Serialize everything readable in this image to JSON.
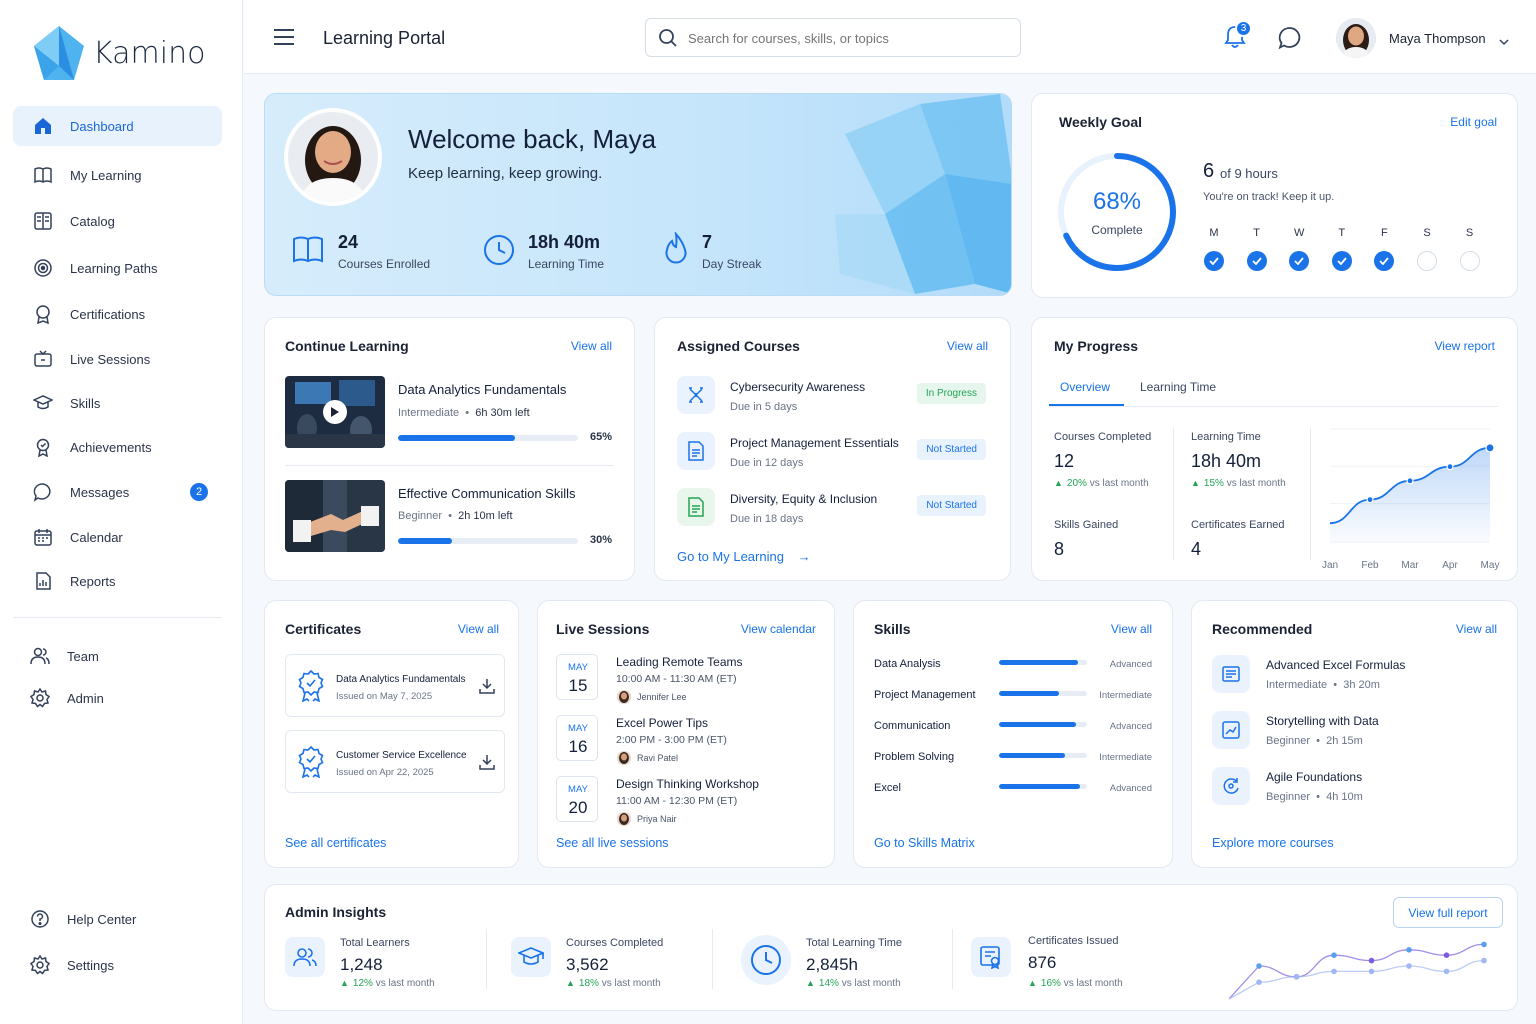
{
  "app": {
    "name": "Kamino",
    "title": "Learning Portal"
  },
  "search": {
    "placeholder": "Search for courses, skills, or topics"
  },
  "user": {
    "name": "Maya Thompson",
    "notifications": "3"
  },
  "sidebar": {
    "items": [
      {
        "label": "Dashboard",
        "icon": "home-icon"
      },
      {
        "label": "My Learning",
        "icon": "book-icon"
      },
      {
        "label": "Catalog",
        "icon": "catalog-icon"
      },
      {
        "label": "Learning Paths",
        "icon": "target-icon"
      },
      {
        "label": "Certifications",
        "icon": "certificate-icon"
      },
      {
        "label": "Live Sessions",
        "icon": "live-icon"
      },
      {
        "label": "Skills",
        "icon": "graduation-icon"
      },
      {
        "label": "Achievements",
        "icon": "medal-icon"
      },
      {
        "label": "Messages",
        "icon": "chat-icon",
        "badge": "2"
      },
      {
        "label": "Calendar",
        "icon": "calendar-icon"
      },
      {
        "label": "Reports",
        "icon": "report-icon"
      }
    ],
    "admin": [
      {
        "label": "Team"
      },
      {
        "label": "Admin"
      }
    ],
    "footer": [
      {
        "label": "Help Center"
      },
      {
        "label": "Settings"
      }
    ]
  },
  "welcome": {
    "title": "Welcome back, Maya",
    "subtitle": "Keep learning, keep growing.",
    "stats": [
      {
        "value": "24",
        "label": "Courses Enrolled"
      },
      {
        "value": "18h 40m",
        "label": "Learning Time"
      },
      {
        "value": "7",
        "label": "Day Streak"
      }
    ]
  },
  "weekly_goal": {
    "title": "Weekly Goal",
    "edit": "Edit goal",
    "percent": "68%",
    "percent_value": 68,
    "complete": "Complete",
    "done": "6",
    "of": "of 9 hours",
    "message": "You're on track! Keep it up.",
    "days": [
      "M",
      "T",
      "W",
      "T",
      "F",
      "S",
      "S"
    ],
    "checked": [
      true,
      true,
      true,
      true,
      true,
      false,
      false
    ]
  },
  "continue": {
    "title": "Continue Learning",
    "view_all": "View all",
    "courses": [
      {
        "title": "Data Analytics Fundamentals",
        "level": "Intermediate",
        "left": "6h 30m left",
        "progress": "65%",
        "pct": 65
      },
      {
        "title": "Effective Communication Skills",
        "level": "Beginner",
        "left": "2h 10m left",
        "progress": "30%",
        "pct": 30
      }
    ]
  },
  "assigned": {
    "title": "Assigned Courses",
    "view_all": "View all",
    "go": "Go to My Learning",
    "items": [
      {
        "title": "Cybersecurity Awareness",
        "due": "Due in 5 days",
        "status": "In Progress"
      },
      {
        "title": "Project Management Essentials",
        "due": "Due in 12 days",
        "status": "Not Started"
      },
      {
        "title": "Diversity, Equity & Inclusion",
        "due": "Due in 18 days",
        "status": "Not Started"
      }
    ]
  },
  "progress": {
    "title": "My Progress",
    "view_report": "View report",
    "tabs": [
      "Overview",
      "Learning Time"
    ],
    "stats": [
      {
        "label": "Courses Completed",
        "value": "12",
        "delta": "20%",
        "vs": "vs last month"
      },
      {
        "label": "Learning Time",
        "value": "18h 40m",
        "delta": "15%",
        "vs": "vs last month"
      },
      {
        "label": "Skills Gained",
        "value": "8"
      },
      {
        "label": "Certificates Earned",
        "value": "4"
      }
    ],
    "chart_data": {
      "type": "area",
      "x": [
        "Jan",
        "Feb",
        "Mar",
        "Apr",
        "May"
      ],
      "values": [
        4,
        9,
        13,
        16,
        20
      ],
      "ylim": [
        0,
        24
      ]
    }
  },
  "certificates": {
    "title": "Certificates",
    "view_all": "View all",
    "see_all": "See all certificates",
    "items": [
      {
        "title": "Data Analytics Fundamentals",
        "issued": "Issued on May 7, 2025"
      },
      {
        "title": "Customer Service Excellence",
        "issued": "Issued on Apr 22, 2025"
      }
    ]
  },
  "live": {
    "title": "Live Sessions",
    "view": "View calendar",
    "see_all": "See all live sessions",
    "items": [
      {
        "month": "MAY",
        "day": "15",
        "title": "Leading Remote Teams",
        "time": "10:00 AM - 11:30 AM (ET)",
        "host": "Jennifer Lee"
      },
      {
        "month": "MAY",
        "day": "16",
        "title": "Excel Power Tips",
        "time": "2:00 PM - 3:00 PM (ET)",
        "host": "Ravi Patel"
      },
      {
        "month": "MAY",
        "day": "20",
        "title": "Design Thinking Workshop",
        "time": "11:00 AM - 12:30 PM (ET)",
        "host": "Priya Nair"
      }
    ]
  },
  "skills": {
    "title": "Skills",
    "view_all": "View all",
    "go": "Go to Skills Matrix",
    "items": [
      {
        "name": "Data Analysis",
        "level": "Advanced",
        "pct": 90
      },
      {
        "name": "Project Management",
        "level": "Intermediate",
        "pct": 68
      },
      {
        "name": "Communication",
        "level": "Advanced",
        "pct": 88
      },
      {
        "name": "Problem Solving",
        "level": "Intermediate",
        "pct": 75
      },
      {
        "name": "Excel",
        "level": "Advanced",
        "pct": 92
      }
    ]
  },
  "recommended": {
    "title": "Recommended",
    "view_all": "View all",
    "explore": "Explore more courses",
    "items": [
      {
        "title": "Advanced Excel Formulas",
        "level": "Intermediate",
        "dur": "3h 20m"
      },
      {
        "title": "Storytelling with Data",
        "level": "Beginner",
        "dur": "2h 15m"
      },
      {
        "title": "Agile Foundations",
        "level": "Beginner",
        "dur": "4h 10m"
      }
    ]
  },
  "admin": {
    "title": "Admin Insights",
    "button": "View full report",
    "stats": [
      {
        "label": "Total Learners",
        "value": "1,248",
        "delta": "12%",
        "vs": "vs last month"
      },
      {
        "label": "Courses Completed",
        "value": "3,562",
        "delta": "18%",
        "vs": "vs last month"
      },
      {
        "label": "Total Learning Time",
        "value": "2,845h",
        "delta": "14%",
        "vs": "vs last month"
      },
      {
        "label": "Certificates Issued",
        "value": "876",
        "delta": "16%",
        "vs": "vs last month"
      }
    ],
    "chart_data": {
      "type": "line",
      "series": [
        {
          "values": [
            5,
            3,
            7,
            6,
            8,
            7,
            9
          ]
        },
        {
          "values": [
            2,
            3,
            4,
            4,
            5,
            4,
            6
          ]
        }
      ],
      "ylim": [
        0,
        10
      ]
    }
  },
  "colors": {
    "accent": "#1a73e8",
    "green": "#23a455",
    "purple": "#7b5ce0"
  }
}
